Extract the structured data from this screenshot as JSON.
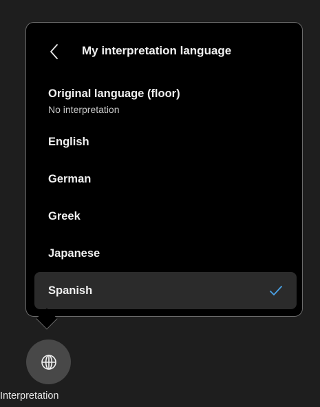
{
  "popover": {
    "title": "My interpretation language",
    "items": [
      {
        "label": "Original language (floor)",
        "sublabel": "No interpretation"
      },
      {
        "label": "English"
      },
      {
        "label": "German"
      },
      {
        "label": "Greek"
      },
      {
        "label": "Japanese"
      },
      {
        "label": "Spanish",
        "selected": true
      }
    ]
  },
  "fab": {
    "label": "Interpretation",
    "icon": "globe-icon"
  },
  "icons": {
    "back": "chevron-left-icon",
    "selected": "checkmark-icon"
  },
  "colors": {
    "accent_check": "#4aa3e8",
    "selected_row": "#2b2b2b",
    "popover_bg": "#000000"
  }
}
